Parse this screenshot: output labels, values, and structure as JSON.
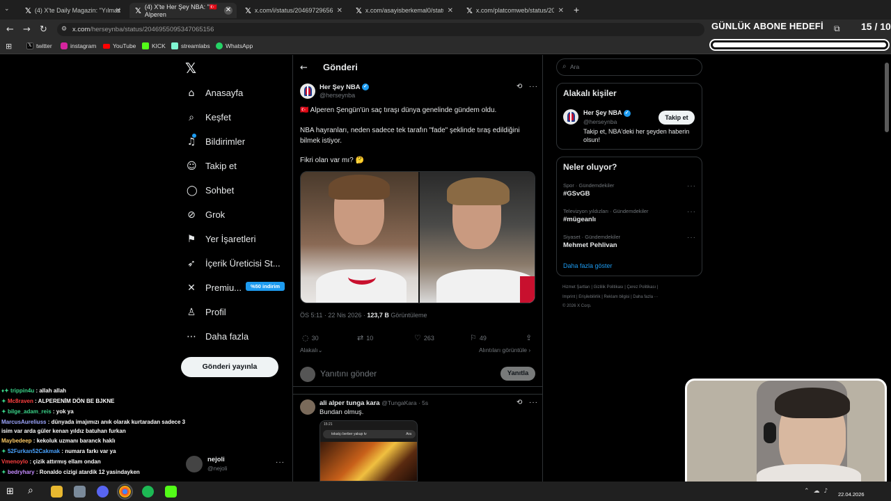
{
  "browser": {
    "tabs": [
      {
        "title": "(4) X'te Daily Magazin: \"Yılmaz"
      },
      {
        "title": "(4) X'te Her Şey NBA: \"🇹🇷 Alperen"
      },
      {
        "title": "x.com/i/status/20469729656868"
      },
      {
        "title": "x.com/asayisberkemal0/status/"
      },
      {
        "title": "x.com/platcomweb/status/2046"
      }
    ],
    "new_tab": "+",
    "url_host": "x.com",
    "url_path": "/herseynba/status/2046955095347065156",
    "bookmarks": [
      {
        "label": "twitter",
        "color": "#000000"
      },
      {
        "label": "instagram",
        "color": "#d6249f"
      },
      {
        "label": "YouTube",
        "color": "#ff0000"
      },
      {
        "label": "KICK",
        "color": "#53fc18"
      },
      {
        "label": "streamlabs",
        "color": "#80f5d2"
      },
      {
        "label": "WhatsApp",
        "color": "#25d366"
      }
    ]
  },
  "overlay": {
    "goal_title": "GÜNLÜK ABONE HEDEFİ",
    "goal_count": "15 / 10",
    "goal_progress": 1.0
  },
  "sidebar": {
    "items": [
      {
        "label": "Anasayfa",
        "icon": "home-icon",
        "glyph": "⌂"
      },
      {
        "label": "Keşfet",
        "icon": "search-icon",
        "glyph": "⌕"
      },
      {
        "label": "Bildirimler",
        "icon": "bell-icon",
        "glyph": "♫"
      },
      {
        "label": "Takip et",
        "icon": "follow-icon",
        "glyph": "☺"
      },
      {
        "label": "Sohbet",
        "icon": "chat-icon",
        "glyph": "◯"
      },
      {
        "label": "Grok",
        "icon": "grok-icon",
        "glyph": "⊘"
      },
      {
        "label": "Yer İşaretleri",
        "icon": "bookmark-icon",
        "glyph": "⚑"
      },
      {
        "label": "İçerik Üreticisi St...",
        "icon": "rocket-icon",
        "glyph": "➶"
      },
      {
        "label": "Premiu...",
        "icon": "x-logo-icon",
        "glyph": "✕"
      },
      {
        "label": "Profil",
        "icon": "profile-icon",
        "glyph": "♙"
      },
      {
        "label": "Daha fazla",
        "icon": "more-icon",
        "glyph": "⋯"
      }
    ],
    "premium_badge": "%50 indirim",
    "post_button": "Gönderi yayınla",
    "account_name": "nejoli",
    "account_handle": "@nejoli"
  },
  "main": {
    "header": "Gönderi",
    "author_name": "Her Şey NBA",
    "author_handle": "@herseynba",
    "post_line1": "🇹🇷 Alperen Şengün'ün saç tıraşı dünya genelinde gündem oldu.",
    "post_line2": "NBA hayranları, neden sadece tek tarafın \"fade\" şeklinde tıraş edildiğini",
    "post_line3": "bilmek istiyor.",
    "post_line4": "Fikri olan var mı? 🤔",
    "time": "ÖS 5:11 · 22 Nis 2026 · ",
    "views": "123,7 B",
    "views_label": " Görüntüleme",
    "stats": {
      "replies": "30",
      "reposts": "10",
      "likes": "263",
      "bookmarks": "49"
    },
    "related": "Alakalı",
    "quotes": "Alıntıları görüntüle ›",
    "reply_placeholder": "Yanıtını gönder",
    "reply_button": "Yanıtla",
    "reply_author": "ali alper tunga kara",
    "reply_handle": "@TungaKara · 5s",
    "reply_text": "Bundan olmuş.",
    "reply_img_time": "15:21",
    "reply_img_search": "tokatçı berber yakup tv",
    "reply_img_btn": "Ara"
  },
  "right": {
    "search_placeholder": "Ara",
    "related_title": "Alakalı kişiler",
    "rel_name": "Her Şey NBA",
    "rel_handle": "@herseynba",
    "rel_follow": "Takip et",
    "rel_bio1": "Takip et, NBA'deki her şeyden haberin",
    "rel_bio2": "olsun!",
    "trends_title": "Neler oluyor?",
    "trends": [
      {
        "cat": "Spor · Gündemdekiler",
        "name": "#GSvGB"
      },
      {
        "cat": "Televizyon yıldızları · Gündemdekiler",
        "name": "#müge­anlı"
      },
      {
        "cat": "Siyaset · Gündemdekiler",
        "name": "Mehmet Pehlivan"
      }
    ],
    "show_more": "Daha fazla göster",
    "footer1": "Hizmet Şartları  |  Gizlilik Politikası  |  Çerez Politikası  |",
    "footer2": "Imprint  |  Erişilebilirlik  |  Reklam bilgisi  |  Daha fazla ···",
    "footer3": "© 2026 X Corp."
  },
  "chat": [
    {
      "user": "trippin4u",
      "msg": " : allah allah",
      "color": "#3ad48a",
      "badge": "♦✦"
    },
    {
      "user": "Mc8raven",
      "msg": " : ALPERENİM DÖN BE BJKNE",
      "color": "#ff4040",
      "badge": "✦"
    },
    {
      "user": "bilge_adam_reis",
      "msg": " : yok ya",
      "color": "#3ad48a",
      "badge": "✦"
    },
    {
      "user": "MarcusAureliuss",
      "msg": " : dünyada imajımızı anık olarak kurtaradan sadece 3",
      "color": "#9ea7ff",
      "badge": ""
    },
    {
      "user": "",
      "msg": "isim var arda güler kenan yıldız batuhan furkan",
      "color": "#fff",
      "badge": ""
    },
    {
      "user": "Maybedeep",
      "msg": " : kekoluk uzmanı baranck haklı",
      "color": "#ffcc66",
      "badge": ""
    },
    {
      "user": "52Furkan52Cakmak",
      "msg": " : numara farkı var ya",
      "color": "#4aa3ff",
      "badge": "✦"
    },
    {
      "user": "Vmenoylo",
      "msg": " : çizik attırmış ellam ondan",
      "color": "#ff4040",
      "badge": ""
    },
    {
      "user": "bedryhary",
      "msg": " : Ronaldo cizigi atardik 12 yasindayken",
      "color": "#c58bff",
      "badge": "✦"
    }
  ],
  "taskbar": {
    "date": "22.04.2026"
  }
}
